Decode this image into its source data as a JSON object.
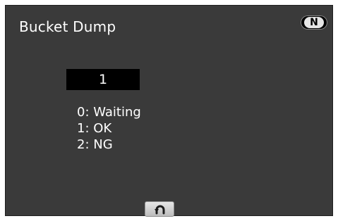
{
  "screen": {
    "title": "Bucket Dump",
    "mode": "N",
    "value": "1",
    "legend": [
      "0: Waiting",
      "1: OK",
      "2: NG"
    ],
    "back_icon": "return-arrow-icon"
  }
}
